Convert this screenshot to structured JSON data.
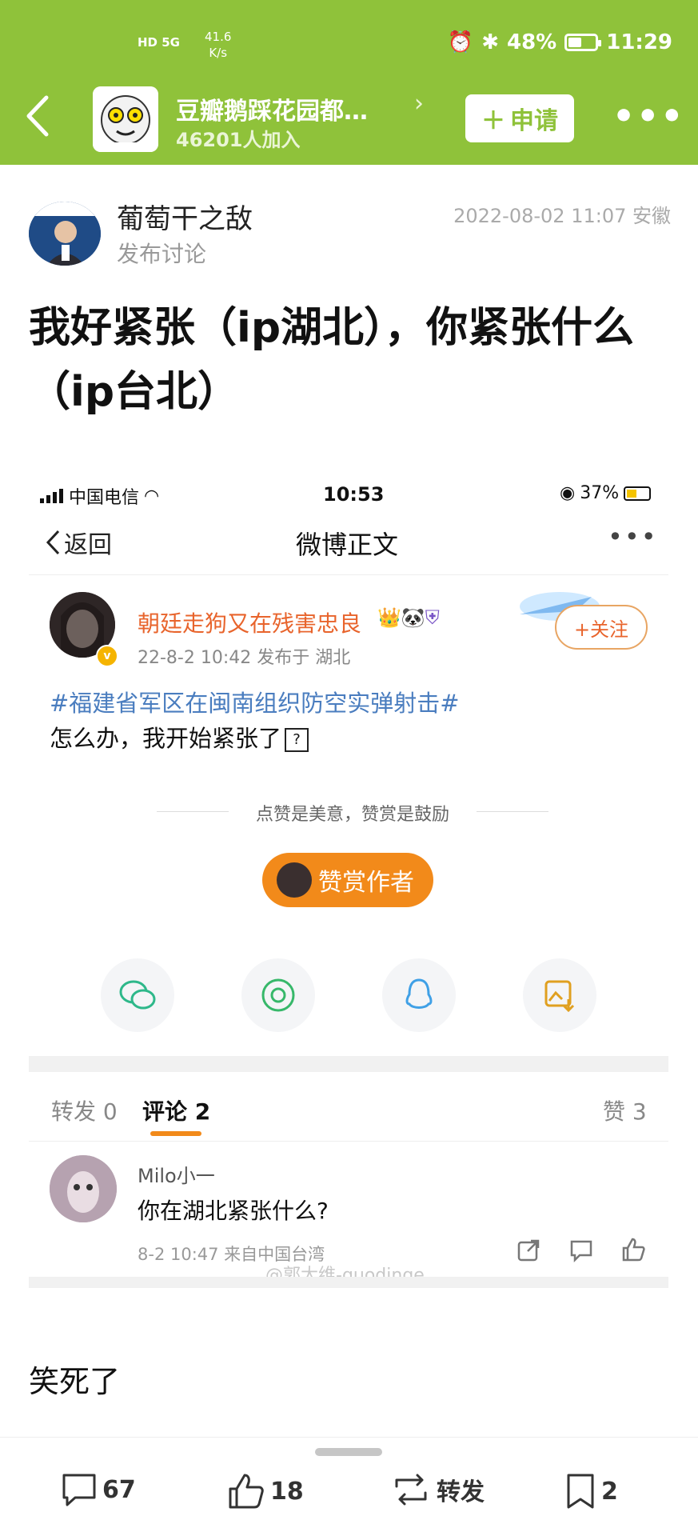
{
  "status_bar": {
    "network": "HD 5G",
    "speed_value": "41.6",
    "speed_unit": "K/s",
    "battery": "48%",
    "time": "11:29"
  },
  "header": {
    "group_name": "豆瓣鹅踩花园都…",
    "member_count": "46201人加入",
    "apply_label": "申请",
    "colors": {
      "brand_green": "#8fc23a"
    }
  },
  "post": {
    "author_name": "葡萄干之敌",
    "author_subtitle": "发布讨论",
    "timestamp": "2022-08-02 11:07 安徽",
    "title": "我好紧张（ip湖北），你紧张什么（ip台北）"
  },
  "embedded": {
    "status": {
      "carrier": "中国电信",
      "time": "10:53",
      "battery": "37%"
    },
    "nav": {
      "back_label": "返回",
      "title": "微博正文"
    },
    "weibo": {
      "username": "朝廷走狗又在残害忠良",
      "meta": "22-8-2 10:42  发布于 湖北",
      "follow_label": "+关注",
      "topic": "#福建省军区在闽南组织防空实弹射击#",
      "text": "怎么办，我开始紧张了"
    },
    "reward_note": "点赞是美意，赞赏是鼓励",
    "reward_button": "赞赏作者",
    "tabs": [
      {
        "label": "转发 0"
      },
      {
        "label": "评论 2"
      },
      {
        "label": "赞 3"
      }
    ],
    "comment": {
      "user": "Milo小一",
      "text": "你在湖北紧张什么?",
      "meta": "8-2 10:47  来自中国台湾"
    },
    "watermark": "@郭大维-guodinge"
  },
  "comment_text": "笑死了",
  "bottom_bar": {
    "comments": "67",
    "likes": "18",
    "repost_label": "转发",
    "bookmarks": "2"
  }
}
